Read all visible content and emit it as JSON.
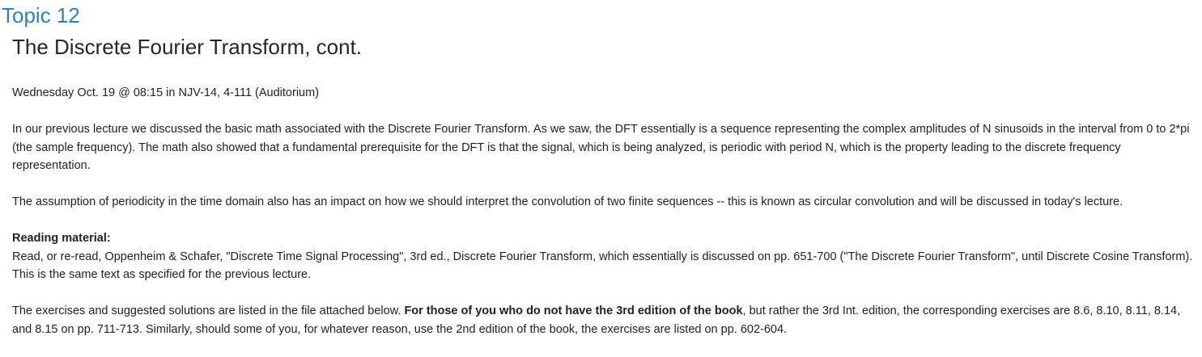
{
  "section": {
    "link_label": "Topic 12"
  },
  "topic": {
    "title": "The Discrete Fourier Transform, cont."
  },
  "summary": {
    "schedule": "Wednesday Oct. 19 @ 08:15 in NJV-14, 4-111 (Auditorium)",
    "intro": "In our previous lecture we discussed the basic math associated with the Discrete Fourier Transform. As we saw, the DFT essentially is a sequence representing the complex amplitudes of N sinusoids in the interval from 0 to 2*pi (the sample frequency). The math also showed that a fundamental prerequisite for the DFT is that the signal, which is being analyzed, is periodic with period N, which is the property leading to the discrete frequency representation.",
    "periodicity": "The assumption of periodicity in the time domain also has an impact on how we should interpret the convolution of two finite sequences -- this is known as circular convolution and will be discussed in today's lecture.",
    "reading_heading": "Reading material:",
    "reading_text": "Read, or re-read, Oppenheim & Schafer, \"Discrete Time Signal Processing\", 3rd ed., Discrete Fourier Transform, which essentially is discussed on pp. 651-700 (\"The Discrete Fourier Transform\", until Discrete Cosine Transform). This is the same text as specified for the previous lecture.",
    "exercises_lead": "The exercises and suggested solutions are listed in the file attached below. ",
    "exercises_bold": "For those of you who do not have the 3rd edition of the book",
    "exercises_tail": ", but rather the 3rd Int. edition, the corresponding exercises are 8.6, 8.10, 8.11, 8.14, and 8.15 on pp. 711-713. Similarly, should some of you, for whatever reason, use the 2nd edition of the book, the exercises are listed on pp. 602-604."
  },
  "colors": {
    "link": "#2f80c2",
    "title": "#262626",
    "text": "#222222",
    "background": "#ffffff"
  }
}
